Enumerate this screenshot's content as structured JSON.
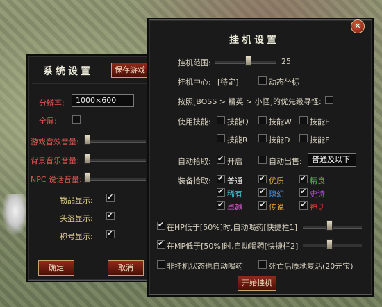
{
  "system": {
    "title": "系统设置",
    "save_label": "保存游戏",
    "resolution_label": "分辨率:",
    "resolution_value": "1000×600",
    "fullscreen_label": "全屏:",
    "sfx_volume_label": "游戏音效音量:",
    "bgm_volume_label": "背景音乐音量:",
    "npc_volume_label": "NPC 说话音量:",
    "item_display_label": "物品显示:",
    "head_display_label": "头盔显示:",
    "title_display_label": "称号显示:",
    "confirm_label": "确定",
    "cancel_label": "取消"
  },
  "hangup": {
    "title": "挂机设置",
    "range_label": "挂机范围:",
    "range_value": "25",
    "center_label": "挂机中心:",
    "center_value": "[待定]",
    "dynamic_coord_label": "动态坐标",
    "priority_label": "按照[BOSS > 精英 > 小怪]的优先级寻怪:",
    "use_skill_label": "使用技能:",
    "skills": [
      "技能Q",
      "技能W",
      "技能E",
      "技能R",
      "技能D",
      "技能F"
    ],
    "auto_pickup_label": "自动拾取:",
    "pickup_on_label": "开启",
    "auto_sell_label": "自动出售:",
    "auto_sell_value": "普通及以下",
    "equip_pickup_label": "装备拾取:",
    "qualities": [
      {
        "name": "普通",
        "color": "#e6e6e6"
      },
      {
        "name": "优质",
        "color": "#e0b040"
      },
      {
        "name": "精良",
        "color": "#43c043"
      },
      {
        "name": "稀有",
        "color": "#3fc7d6"
      },
      {
        "name": "瑰幻",
        "color": "#3a8fe8"
      },
      {
        "name": "史诗",
        "color": "#b04ad8"
      },
      {
        "name": "卓越",
        "color": "#d85bd0"
      },
      {
        "name": "传说",
        "color": "#e8a23a"
      },
      {
        "name": "神话",
        "color": "#e04030"
      }
    ],
    "hp_potion_label": "在HP低于[50%]时,自动喝药[快捷栏1]",
    "mp_potion_label": "在MP低于[50%]时,自动喝药[快捷栏2]",
    "non_hangup_potion_label": "非挂机状态也自动喝药",
    "revive_label": "死亡后原地复活(20元宝)",
    "start_label": "开始挂机",
    "close_symbol": "✕"
  }
}
